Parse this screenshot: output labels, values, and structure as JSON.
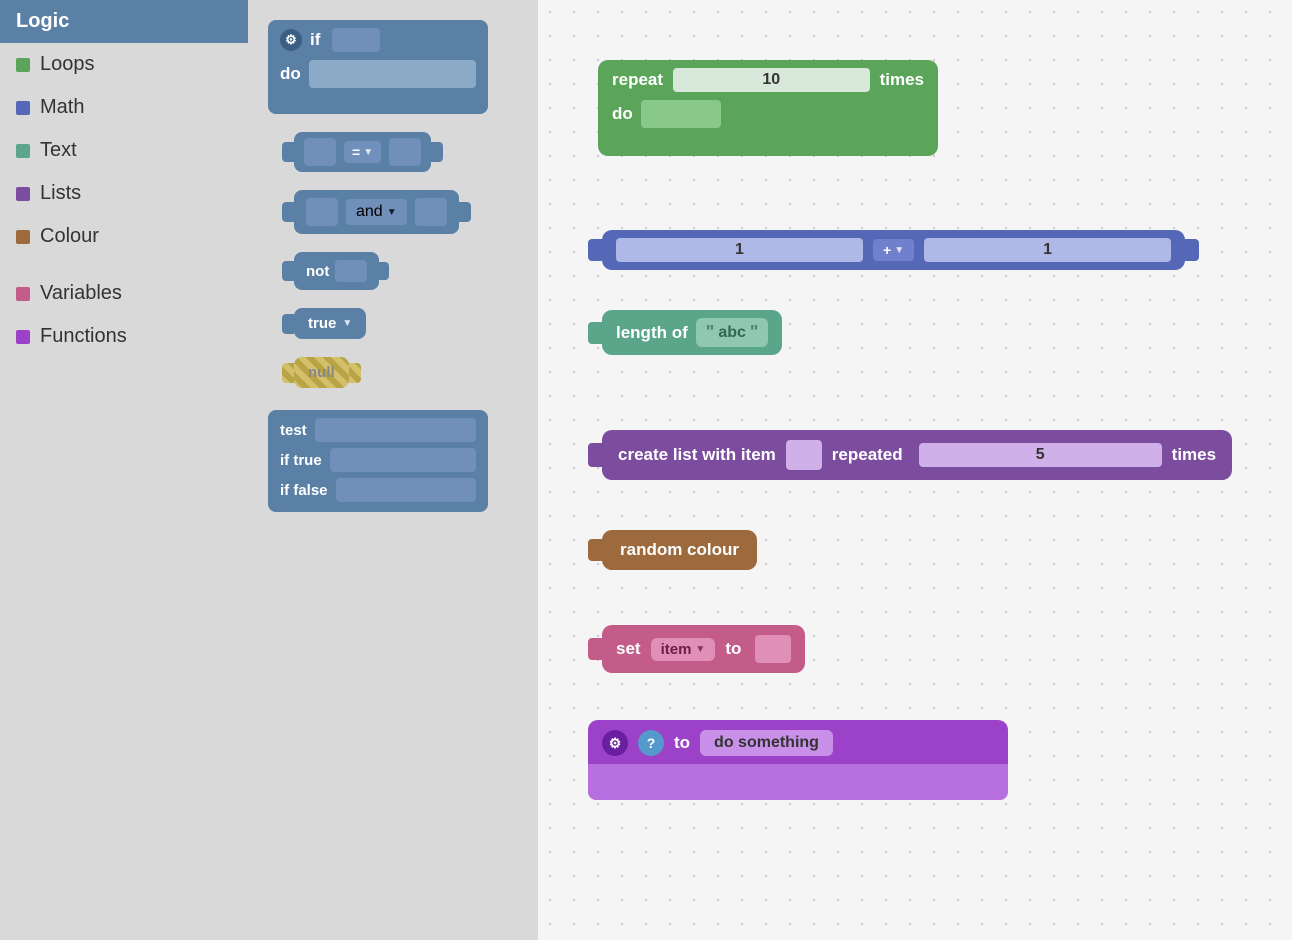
{
  "sidebar": {
    "items": [
      {
        "label": "Logic",
        "color": "#5b80a5",
        "active": true,
        "dot": null
      },
      {
        "label": "Loops",
        "color": "#5ba55b",
        "active": false,
        "dot": "#5ba55b"
      },
      {
        "label": "Math",
        "color": "#5568b8",
        "active": false,
        "dot": "#5568b8"
      },
      {
        "label": "Text",
        "color": "#5ba58a",
        "active": false,
        "dot": "#5ba58a"
      },
      {
        "label": "Lists",
        "color": "#7c4d9f",
        "active": false,
        "dot": "#7c4d9f"
      },
      {
        "label": "Colour",
        "color": "#9c6a3c",
        "active": false,
        "dot": "#9c6a3c"
      },
      {
        "label": "Variables",
        "color": "#c45c8a",
        "active": false,
        "dot": "#c45c8a"
      },
      {
        "label": "Functions",
        "color": "#9b42c8",
        "active": false,
        "dot": "#9b42c8"
      }
    ]
  },
  "blocks_panel": {
    "if_label": "if",
    "do_label": "do",
    "eq_label": "=",
    "and_label": "and",
    "not_label": "not",
    "true_label": "true",
    "null_label": "null",
    "test_label": "test",
    "if_true_label": "if true",
    "if_false_label": "if false"
  },
  "canvas": {
    "repeat_block": {
      "label": "repeat",
      "times_label": "times",
      "do_label": "do",
      "value": "10"
    },
    "math_block": {
      "left": "1",
      "op": "+",
      "right": "1"
    },
    "length_block": {
      "label": "length of",
      "text_value": "abc"
    },
    "list_block": {
      "label": "create list with item",
      "repeated_label": "repeated",
      "times_label": "times",
      "value": "5"
    },
    "colour_block": {
      "label": "random colour"
    },
    "var_block": {
      "set_label": "set",
      "item_label": "item",
      "to_label": "to"
    },
    "func_block": {
      "to_label": "to",
      "name_value": "do something"
    }
  }
}
